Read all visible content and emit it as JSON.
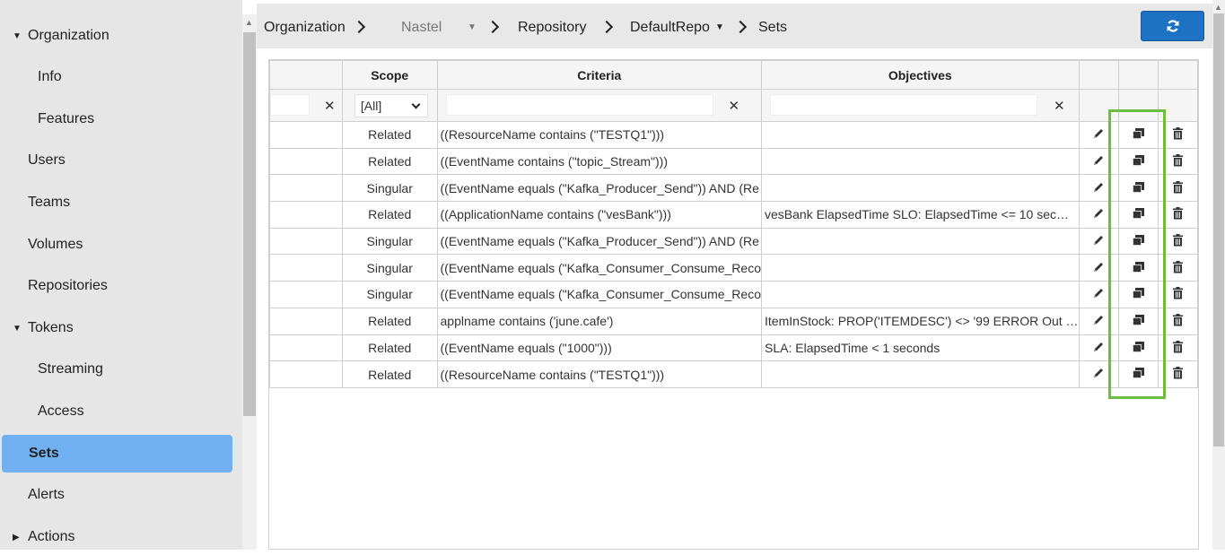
{
  "sidebar": {
    "items": [
      {
        "label": "Organization",
        "expanded": true
      },
      {
        "label": "Info"
      },
      {
        "label": "Features"
      },
      {
        "label": "Users"
      },
      {
        "label": "Teams"
      },
      {
        "label": "Volumes"
      },
      {
        "label": "Repositories"
      },
      {
        "label": "Tokens",
        "expanded": true
      },
      {
        "label": "Streaming"
      },
      {
        "label": "Access"
      },
      {
        "label": "Sets",
        "active": true
      },
      {
        "label": "Alerts"
      },
      {
        "label": "Actions",
        "expanded": false
      }
    ]
  },
  "breadcrumb": {
    "organization": "Organization",
    "org_name": "Nastel",
    "repository": "Repository",
    "repo_name": "DefaultRepo",
    "current": "Sets"
  },
  "toolbar": {
    "refresh_icon": "refresh-icon"
  },
  "grid": {
    "headers": {
      "scope": "Scope",
      "criteria": "Criteria",
      "objectives": "Objectives"
    },
    "filters": {
      "scope_selected": "[All]",
      "clear_icon": "clear-x-icon"
    },
    "rows": [
      {
        "scope": "Related",
        "criteria": "((ResourceName contains (\"TESTQ1\")))",
        "objectives": ""
      },
      {
        "scope": "Related",
        "criteria": "((EventName contains (\"topic_Stream\")))",
        "objectives": ""
      },
      {
        "scope": "Singular",
        "criteria": "((EventName equals (\"Kafka_Producer_Send\")) AND (Re",
        "objectives": ""
      },
      {
        "scope": "Related",
        "criteria": "((ApplicationName contains (\"vesBank\")))",
        "objectives": "vesBank ElapsedTime SLO: ElapsedTime <= 10 sec…"
      },
      {
        "scope": "Singular",
        "criteria": "((EventName equals (\"Kafka_Producer_Send\")) AND (Re",
        "objectives": ""
      },
      {
        "scope": "Singular",
        "criteria": "((EventName equals (\"Kafka_Consumer_Consume_Reco",
        "objectives": ""
      },
      {
        "scope": "Singular",
        "criteria": "((EventName equals (\"Kafka_Consumer_Consume_Reco",
        "objectives": ""
      },
      {
        "scope": "Related",
        "criteria": "applname contains ('june.cafe')",
        "objectives": "ItemInStock: PROP('ITEMDESC') <> '99 ERROR Out …"
      },
      {
        "scope": "Related",
        "criteria": "((EventName equals (\"1000\")))",
        "objectives": "SLA: ElapsedTime < 1 seconds"
      },
      {
        "scope": "Related",
        "criteria": "((ResourceName contains (\"TESTQ1\")))",
        "objectives": ""
      }
    ],
    "row_icons": [
      "edit-pencil-icon",
      "copy-icon",
      "delete-trash-icon"
    ]
  },
  "colors": {
    "accent": "#1d72c4",
    "active_nav": "#71b1f3",
    "highlight": "#6fbd3f",
    "sidebar_bg": "#e6e6e6"
  }
}
